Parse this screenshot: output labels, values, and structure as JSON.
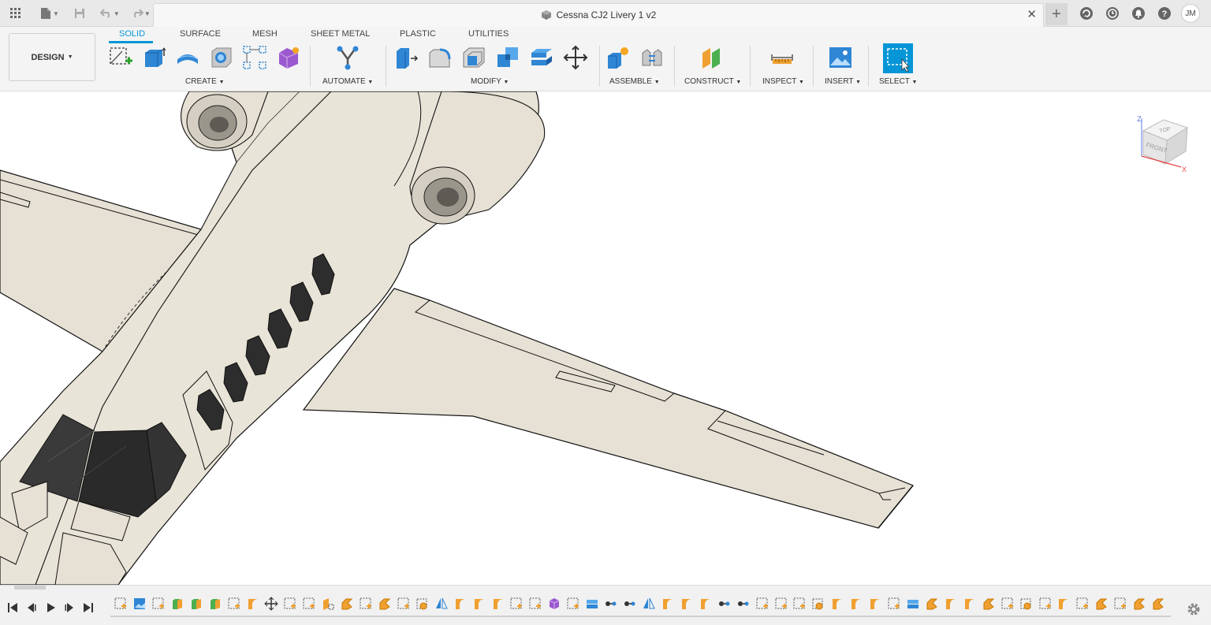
{
  "titlebar": {
    "document_title": "Cessna CJ2 Livery 1 v2",
    "close_label": "✕",
    "new_tab_label": "+",
    "user_initials": "JM",
    "icons": [
      "grid-icon",
      "file-icon",
      "save-icon",
      "undo-icon",
      "redo-icon",
      "extensions-icon",
      "job-status-icon",
      "notifications-icon",
      "help-icon"
    ]
  },
  "toolbar": {
    "workspace_label": "DESIGN",
    "tabs": [
      "SOLID",
      "SURFACE",
      "MESH",
      "SHEET METAL",
      "PLASTIC",
      "UTILITIES"
    ],
    "active_tab": "SOLID",
    "groups": {
      "create": "CREATE",
      "automate": "AUTOMATE",
      "modify": "MODIFY",
      "assemble": "ASSEMBLE",
      "construct": "CONSTRUCT",
      "inspect": "INSPECT",
      "insert": "INSERT",
      "select": "SELECT"
    },
    "accent": "#0696d7"
  },
  "viewcube": {
    "top": "TOP",
    "front": "FRONT",
    "axis_z": "Z",
    "axis_x": "X"
  },
  "model": {
    "body_color": "#e9e4d8",
    "window_color": "#2d2d2d"
  },
  "timeline": {
    "feature_count": 56,
    "feature_types": [
      "sketch",
      "canvas",
      "sketch",
      "extrude",
      "extrude",
      "extrude",
      "sketch",
      "fillet",
      "move",
      "sketch",
      "sketch",
      "plane",
      "chamfer",
      "sketch",
      "chamfer",
      "sketch",
      "shell",
      "mirror",
      "fillet",
      "fillet",
      "fillet",
      "sketch",
      "sketch",
      "component",
      "sketch",
      "split",
      "joint",
      "joint",
      "mirror",
      "fillet",
      "fillet",
      "fillet",
      "joint",
      "joint",
      "sketch",
      "sketch",
      "sketch",
      "shell",
      "fillet",
      "fillet",
      "fillet",
      "sketch",
      "split",
      "chamfer",
      "fillet",
      "fillet",
      "chamfer",
      "sketch",
      "shell",
      "sketch",
      "fillet",
      "sketch",
      "chamfer",
      "sketch",
      "chamfer",
      "chamfer"
    ]
  }
}
